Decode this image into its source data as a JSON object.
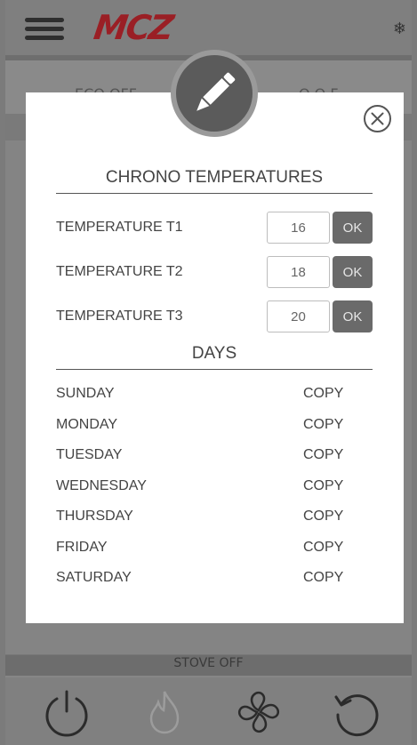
{
  "header": {
    "logo_text": "MCZ",
    "menu_icon": "hamburger-menu-icon",
    "mode_icon": "snowflake-icon"
  },
  "background": {
    "row_left": "ECO OFF",
    "row_center": "I",
    "row_right": "O O F"
  },
  "status": {
    "text": "STOVE OFF"
  },
  "bottom_bar": {
    "icons": [
      "power-icon",
      "flame-icon",
      "fan-icon",
      "reset-icon"
    ]
  },
  "modal": {
    "badge_icon": "pencil-icon",
    "close_icon": "close-circle-icon",
    "chrono_title": "CHRONO TEMPERATURES",
    "temperatures": [
      {
        "label": "TEMPERATURE T1",
        "value": "16",
        "ok": "OK"
      },
      {
        "label": "TEMPERATURE T2",
        "value": "18",
        "ok": "OK"
      },
      {
        "label": "TEMPERATURE T3",
        "value": "20",
        "ok": "OK"
      }
    ],
    "days_title": "DAYS",
    "days": [
      {
        "name": "SUNDAY",
        "action": "COPY"
      },
      {
        "name": "MONDAY",
        "action": "COPY"
      },
      {
        "name": "TUESDAY",
        "action": "COPY"
      },
      {
        "name": "WEDNESDAY",
        "action": "COPY"
      },
      {
        "name": "THURSDAY",
        "action": "COPY"
      },
      {
        "name": "FRIDAY",
        "action": "COPY"
      },
      {
        "name": "SATURDAY",
        "action": "COPY"
      }
    ]
  },
  "colors": {
    "logo_red": "#9a1f25",
    "overlay_gray": "#868686",
    "ok_button": "#6a6a6a",
    "badge": "#5b5b5b"
  }
}
